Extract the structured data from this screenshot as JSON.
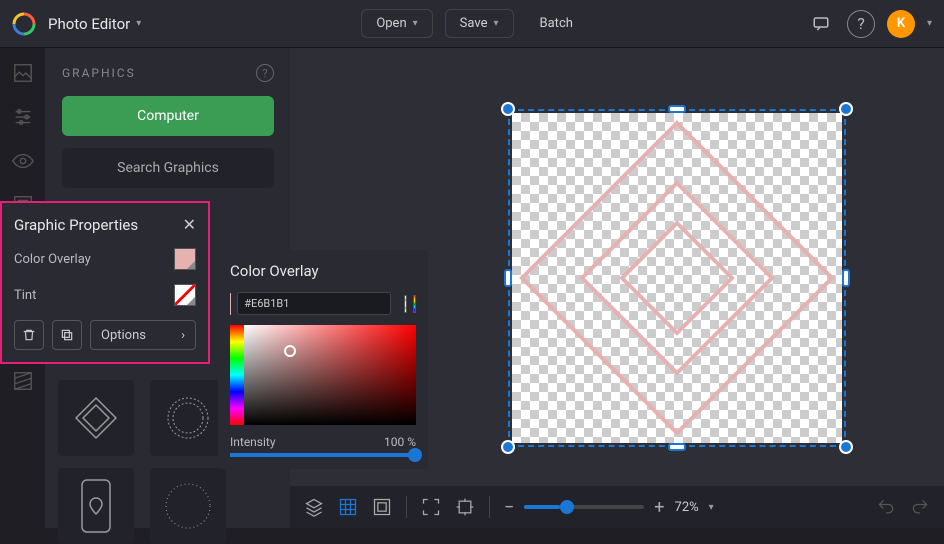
{
  "header": {
    "app_title": "Photo Editor",
    "open_label": "Open",
    "save_label": "Save",
    "batch_label": "Batch",
    "avatar_initial": "K"
  },
  "sidebar": {
    "title": "GRAPHICS",
    "computer_btn": "Computer",
    "search_btn": "Search Graphics"
  },
  "properties_modal": {
    "title": "Graphic Properties",
    "color_overlay_label": "Color Overlay",
    "tint_label": "Tint",
    "options_label": "Options",
    "color_overlay_value": "#E6B1B1"
  },
  "color_panel": {
    "title": "Color Overlay",
    "hex_prefix": "#",
    "hex_value": "E6B1B1",
    "intensity_label": "Intensity",
    "intensity_value": "100 %"
  },
  "bottombar": {
    "zoom_value": "72%"
  },
  "colors": {
    "accent": "#1b77d6",
    "highlight": "#e91e7a",
    "overlay": "#E6B1B1",
    "green": "#3a9d53"
  }
}
